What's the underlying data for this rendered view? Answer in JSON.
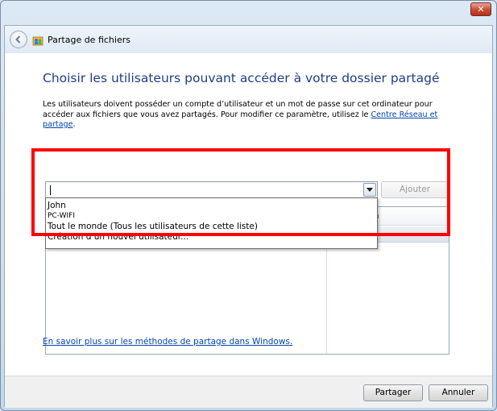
{
  "window": {
    "title": "Partage de fichiers",
    "close_label": "✕"
  },
  "heading": "Choisir les utilisateurs pouvant accéder à votre dossier partagé",
  "description": {
    "text": "Les utilisateurs doivent posséder un compte d’utilisateur et un mot de passe sur cet ordinateur pour accéder aux fichiers que vous avez partagés. Pour modifier ce paramètre, utilisez le ",
    "link": "Centre Réseau et partage",
    "suffix": "."
  },
  "user_input": {
    "value": ""
  },
  "buttons": {
    "add": "Ajouter",
    "share": "Partager",
    "cancel": "Annuler"
  },
  "dropdown": {
    "items": [
      "John",
      "PC-WIFI",
      "Tout le monde (Tous les utilisateurs de cette liste)",
      "Création d’un nouvel utilisateur..."
    ]
  },
  "table": {
    "col_permission_visible": "utorisation",
    "row_permission_visible": "e ▼"
  },
  "help_link": "En savoir plus sur les méthodes de partage dans Windows.",
  "colors": {
    "heading": "#1e3e8a",
    "link": "#0645ad",
    "highlight": "#ff0000"
  }
}
